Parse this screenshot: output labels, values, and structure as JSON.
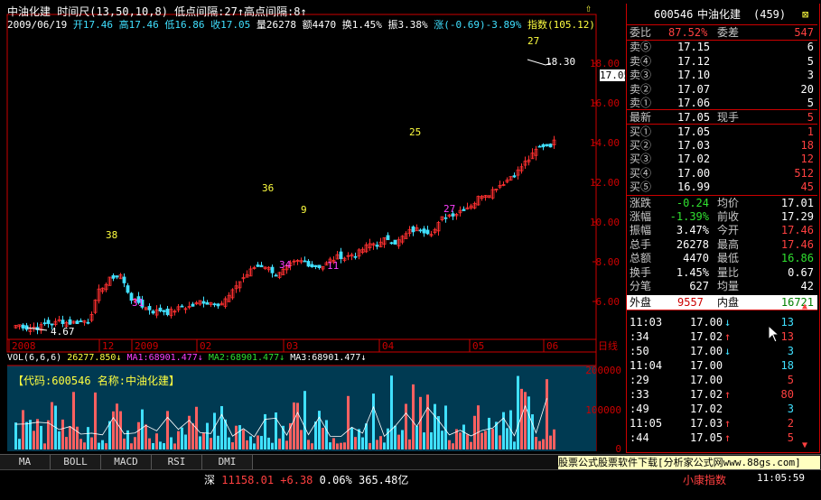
{
  "header": {
    "line1": "中油化建 时间尺(13,50,10,8) 低点间隔:27↑高点间隔:8↑",
    "date": "2009/06/19",
    "open": "开17.46",
    "high": "高17.46",
    "low": "低16.86",
    "close": "收17.05",
    "vol": "量26278",
    "amount": "额4470",
    "turnover": "换1.45%",
    "amp": "振3.38%",
    "change": "涨(-0.69)-3.89%",
    "index": "指数(105.12)"
  },
  "price_axis": [
    "18.00",
    "16.00",
    "14.00",
    "12.00",
    "10.00",
    "8.00",
    "6.00"
  ],
  "current_price": "17.05",
  "annotations": [
    {
      "text": "27",
      "color": "#ffff40"
    },
    {
      "text": "18.30",
      "color": "#ffffff"
    },
    {
      "text": "25",
      "color": "#ffff40"
    },
    {
      "text": "27",
      "color": "#ff40ff"
    },
    {
      "text": "36",
      "color": "#ffff40"
    },
    {
      "text": "9",
      "color": "#ffff40"
    },
    {
      "text": "34",
      "color": "#ff40ff"
    },
    {
      "text": "11",
      "color": "#ff40ff"
    },
    {
      "text": "38",
      "color": "#ffff40"
    },
    {
      "text": "31",
      "color": "#ff40ff"
    },
    {
      "text": "4.67",
      "color": "#ffffff"
    }
  ],
  "date_axis": [
    "2008",
    "12",
    "2009",
    "02",
    "03",
    "04",
    "05",
    "06"
  ],
  "date_axis_right": "日线",
  "vol_header": {
    "label": "VOL(6,6,6)",
    "v": "26277.850",
    "ma1": "MA1:68901.477",
    "ma2": "MA2:68901.477",
    "ma3": "MA3:68901.477"
  },
  "vol_info": "【代码:600546 名称:中油化建】",
  "vol_axis": [
    "200000",
    "100000",
    "0"
  ],
  "tabs": [
    "MA",
    "BOLL",
    "MACD",
    "RSI",
    "DMI"
  ],
  "status": {
    "market": "深",
    "index_value": "11158.01",
    "index_change": "+6.38",
    "index_pct": "0.06%",
    "turnover": "365.48亿",
    "banner": "股票公式股票软件下载[分析家公式网www.88gs.com]",
    "small": "小康指数",
    "time": "11:05:59"
  },
  "quote": {
    "code": "600546",
    "name": "中油化建",
    "count": "(459)",
    "weibi_label": "委比",
    "weibi": "87.52%",
    "weicha_label": "委差",
    "weicha": "547",
    "sells": [
      {
        "label": "卖⑤",
        "price": "17.15",
        "vol": "6"
      },
      {
        "label": "卖④",
        "price": "17.12",
        "vol": "5"
      },
      {
        "label": "卖③",
        "price": "17.10",
        "vol": "3"
      },
      {
        "label": "卖②",
        "price": "17.07",
        "vol": "20"
      },
      {
        "label": "卖①",
        "price": "17.06",
        "vol": "5"
      }
    ],
    "last_label": "最新",
    "last": "17.05",
    "xianshou_label": "现手",
    "xianshou": "5",
    "buys": [
      {
        "label": "买①",
        "price": "17.05",
        "vol": "1"
      },
      {
        "label": "买②",
        "price": "17.03",
        "vol": "18"
      },
      {
        "label": "买③",
        "price": "17.02",
        "vol": "12"
      },
      {
        "label": "买④",
        "price": "17.00",
        "vol": "512"
      },
      {
        "label": "买⑤",
        "price": "16.99",
        "vol": "45"
      }
    ],
    "stats": [
      {
        "l1": "涨跌",
        "v1": "-0.24",
        "c1": "green",
        "l2": "均价",
        "v2": "17.01",
        "c2": "white"
      },
      {
        "l1": "涨幅",
        "v1": "-1.39%",
        "c1": "green",
        "l2": "前收",
        "v2": "17.29",
        "c2": "white"
      },
      {
        "l1": "振幅",
        "v1": "3.47%",
        "c1": "white",
        "l2": "今开",
        "v2": "17.46",
        "c2": "red"
      },
      {
        "l1": "总手",
        "v1": "26278",
        "c1": "white",
        "l2": "最高",
        "v2": "17.46",
        "c2": "red"
      },
      {
        "l1": "总额",
        "v1": "4470",
        "c1": "white",
        "l2": "最低",
        "v2": "16.86",
        "c2": "green"
      },
      {
        "l1": "换手",
        "v1": "1.45%",
        "c1": "white",
        "l2": "量比",
        "v2": "0.67",
        "c2": "white"
      },
      {
        "l1": "分笔",
        "v1": "627",
        "c1": "white",
        "l2": "均量",
        "v2": "42",
        "c2": "white"
      }
    ],
    "outer_label": "外盘",
    "outer": "9557",
    "inner_label": "内盘",
    "inner": "16721",
    "ticks": [
      {
        "t": "11:03",
        "p": "17.00",
        "a": "↓",
        "ac": "#40e0ff",
        "v": "13",
        "vc": "#40e0ff"
      },
      {
        "t": ":34",
        "p": "17.02",
        "a": "↑",
        "ac": "#ff4040",
        "v": "13",
        "vc": "#ff4040"
      },
      {
        "t": ":50",
        "p": "17.00",
        "a": "↓",
        "ac": "#40e0ff",
        "v": "3",
        "vc": "#40e0ff"
      },
      {
        "t": "11:04",
        "p": "17.00",
        "a": "",
        "ac": "#fff",
        "v": "18",
        "vc": "#40e0ff"
      },
      {
        "t": ":29",
        "p": "17.00",
        "a": "",
        "ac": "#fff",
        "v": "5",
        "vc": "#ff4040"
      },
      {
        "t": ":33",
        "p": "17.02",
        "a": "↑",
        "ac": "#ff4040",
        "v": "80",
        "vc": "#ff4040"
      },
      {
        "t": ":49",
        "p": "17.02",
        "a": "",
        "ac": "#fff",
        "v": "3",
        "vc": "#40e0ff"
      },
      {
        "t": "11:05",
        "p": "17.03",
        "a": "↑",
        "ac": "#ff4040",
        "v": "2",
        "vc": "#ff4040"
      },
      {
        "t": ":44",
        "p": "17.05",
        "a": "↑",
        "ac": "#ff4040",
        "v": "5",
        "vc": "#ff4040"
      }
    ]
  }
}
